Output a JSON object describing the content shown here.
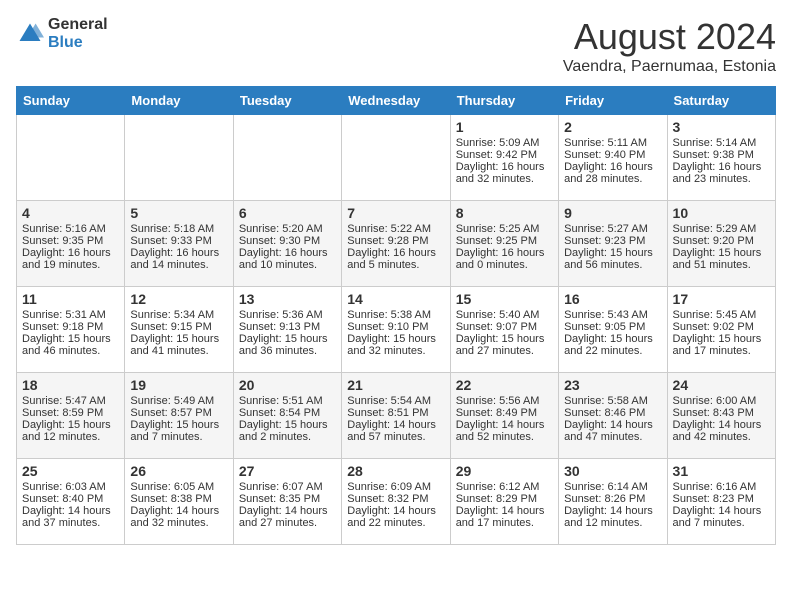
{
  "logo": {
    "general": "General",
    "blue": "Blue"
  },
  "title": "August 2024",
  "subtitle": "Vaendra, Paernumaa, Estonia",
  "headers": [
    "Sunday",
    "Monday",
    "Tuesday",
    "Wednesday",
    "Thursday",
    "Friday",
    "Saturday"
  ],
  "weeks": [
    [
      {
        "day": "",
        "lines": []
      },
      {
        "day": "",
        "lines": []
      },
      {
        "day": "",
        "lines": []
      },
      {
        "day": "",
        "lines": []
      },
      {
        "day": "1",
        "lines": [
          "Sunrise: 5:09 AM",
          "Sunset: 9:42 PM",
          "Daylight: 16 hours",
          "and 32 minutes."
        ]
      },
      {
        "day": "2",
        "lines": [
          "Sunrise: 5:11 AM",
          "Sunset: 9:40 PM",
          "Daylight: 16 hours",
          "and 28 minutes."
        ]
      },
      {
        "day": "3",
        "lines": [
          "Sunrise: 5:14 AM",
          "Sunset: 9:38 PM",
          "Daylight: 16 hours",
          "and 23 minutes."
        ]
      }
    ],
    [
      {
        "day": "4",
        "lines": [
          "Sunrise: 5:16 AM",
          "Sunset: 9:35 PM",
          "Daylight: 16 hours",
          "and 19 minutes."
        ]
      },
      {
        "day": "5",
        "lines": [
          "Sunrise: 5:18 AM",
          "Sunset: 9:33 PM",
          "Daylight: 16 hours",
          "and 14 minutes."
        ]
      },
      {
        "day": "6",
        "lines": [
          "Sunrise: 5:20 AM",
          "Sunset: 9:30 PM",
          "Daylight: 16 hours",
          "and 10 minutes."
        ]
      },
      {
        "day": "7",
        "lines": [
          "Sunrise: 5:22 AM",
          "Sunset: 9:28 PM",
          "Daylight: 16 hours",
          "and 5 minutes."
        ]
      },
      {
        "day": "8",
        "lines": [
          "Sunrise: 5:25 AM",
          "Sunset: 9:25 PM",
          "Daylight: 16 hours",
          "and 0 minutes."
        ]
      },
      {
        "day": "9",
        "lines": [
          "Sunrise: 5:27 AM",
          "Sunset: 9:23 PM",
          "Daylight: 15 hours",
          "and 56 minutes."
        ]
      },
      {
        "day": "10",
        "lines": [
          "Sunrise: 5:29 AM",
          "Sunset: 9:20 PM",
          "Daylight: 15 hours",
          "and 51 minutes."
        ]
      }
    ],
    [
      {
        "day": "11",
        "lines": [
          "Sunrise: 5:31 AM",
          "Sunset: 9:18 PM",
          "Daylight: 15 hours",
          "and 46 minutes."
        ]
      },
      {
        "day": "12",
        "lines": [
          "Sunrise: 5:34 AM",
          "Sunset: 9:15 PM",
          "Daylight: 15 hours",
          "and 41 minutes."
        ]
      },
      {
        "day": "13",
        "lines": [
          "Sunrise: 5:36 AM",
          "Sunset: 9:13 PM",
          "Daylight: 15 hours",
          "and 36 minutes."
        ]
      },
      {
        "day": "14",
        "lines": [
          "Sunrise: 5:38 AM",
          "Sunset: 9:10 PM",
          "Daylight: 15 hours",
          "and 32 minutes."
        ]
      },
      {
        "day": "15",
        "lines": [
          "Sunrise: 5:40 AM",
          "Sunset: 9:07 PM",
          "Daylight: 15 hours",
          "and 27 minutes."
        ]
      },
      {
        "day": "16",
        "lines": [
          "Sunrise: 5:43 AM",
          "Sunset: 9:05 PM",
          "Daylight: 15 hours",
          "and 22 minutes."
        ]
      },
      {
        "day": "17",
        "lines": [
          "Sunrise: 5:45 AM",
          "Sunset: 9:02 PM",
          "Daylight: 15 hours",
          "and 17 minutes."
        ]
      }
    ],
    [
      {
        "day": "18",
        "lines": [
          "Sunrise: 5:47 AM",
          "Sunset: 8:59 PM",
          "Daylight: 15 hours",
          "and 12 minutes."
        ]
      },
      {
        "day": "19",
        "lines": [
          "Sunrise: 5:49 AM",
          "Sunset: 8:57 PM",
          "Daylight: 15 hours",
          "and 7 minutes."
        ]
      },
      {
        "day": "20",
        "lines": [
          "Sunrise: 5:51 AM",
          "Sunset: 8:54 PM",
          "Daylight: 15 hours",
          "and 2 minutes."
        ]
      },
      {
        "day": "21",
        "lines": [
          "Sunrise: 5:54 AM",
          "Sunset: 8:51 PM",
          "Daylight: 14 hours",
          "and 57 minutes."
        ]
      },
      {
        "day": "22",
        "lines": [
          "Sunrise: 5:56 AM",
          "Sunset: 8:49 PM",
          "Daylight: 14 hours",
          "and 52 minutes."
        ]
      },
      {
        "day": "23",
        "lines": [
          "Sunrise: 5:58 AM",
          "Sunset: 8:46 PM",
          "Daylight: 14 hours",
          "and 47 minutes."
        ]
      },
      {
        "day": "24",
        "lines": [
          "Sunrise: 6:00 AM",
          "Sunset: 8:43 PM",
          "Daylight: 14 hours",
          "and 42 minutes."
        ]
      }
    ],
    [
      {
        "day": "25",
        "lines": [
          "Sunrise: 6:03 AM",
          "Sunset: 8:40 PM",
          "Daylight: 14 hours",
          "and 37 minutes."
        ]
      },
      {
        "day": "26",
        "lines": [
          "Sunrise: 6:05 AM",
          "Sunset: 8:38 PM",
          "Daylight: 14 hours",
          "and 32 minutes."
        ]
      },
      {
        "day": "27",
        "lines": [
          "Sunrise: 6:07 AM",
          "Sunset: 8:35 PM",
          "Daylight: 14 hours",
          "and 27 minutes."
        ]
      },
      {
        "day": "28",
        "lines": [
          "Sunrise: 6:09 AM",
          "Sunset: 8:32 PM",
          "Daylight: 14 hours",
          "and 22 minutes."
        ]
      },
      {
        "day": "29",
        "lines": [
          "Sunrise: 6:12 AM",
          "Sunset: 8:29 PM",
          "Daylight: 14 hours",
          "and 17 minutes."
        ]
      },
      {
        "day": "30",
        "lines": [
          "Sunrise: 6:14 AM",
          "Sunset: 8:26 PM",
          "Daylight: 14 hours",
          "and 12 minutes."
        ]
      },
      {
        "day": "31",
        "lines": [
          "Sunrise: 6:16 AM",
          "Sunset: 8:23 PM",
          "Daylight: 14 hours",
          "and 7 minutes."
        ]
      }
    ]
  ]
}
